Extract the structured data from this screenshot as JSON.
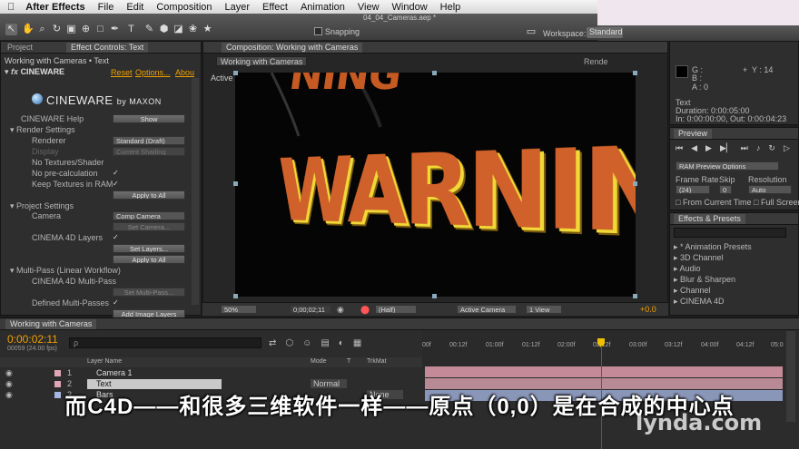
{
  "menubar": {
    "app_name": "After Effects",
    "items": [
      "File",
      "Edit",
      "Composition",
      "Layer",
      "Effect",
      "Animation",
      "View",
      "Window",
      "Help"
    ]
  },
  "document": {
    "title": "04_04_Cameras.aep *"
  },
  "toolbar": {
    "snapping_label": "Snapping",
    "workspace_label": "Workspace:",
    "workspace_value": "Standard"
  },
  "project_panel": {
    "tab_project": "Project",
    "tab_effect_controls": "Effect Controls: Text",
    "header": "Working with Cameras • Text"
  },
  "effect": {
    "name": "CINEWARE",
    "reset": "Reset",
    "options": "Options...",
    "about": "Abou",
    "logo_main": "CINEWARE",
    "logo_by": "by MAXON",
    "help_label": "CINEWARE Help",
    "help_button": "Show",
    "render_settings": "Render Settings",
    "renderer_label": "Renderer",
    "renderer_value": "Standard (Draft)",
    "display_label": "Display",
    "display_value": "Current Shading",
    "no_textures": "No Textures/Shader",
    "no_precalc": "No pre-calculation",
    "keep_textures": "Keep Textures in RAM",
    "apply_all_1": "Apply to All",
    "project_settings": "Project Settings",
    "camera_label": "Camera",
    "camera_value": "Comp Camera",
    "set_camera": "Set Camera...",
    "c4d_layers": "CINEMA 4D Layers",
    "set_layers": "Set Layers...",
    "apply_all_2": "Apply to All",
    "multipass": "Multi-Pass (Linear Workflow)",
    "c4d_multipass": "CINEMA 4D Multi-Pass",
    "set_multipass": "Set Multi-Pass...",
    "defined_multipasses": "Defined Multi-Passes",
    "add_image_layers": "Add Image Layers"
  },
  "comp_panel": {
    "tab": "Composition: Working with Cameras",
    "subtab": "Working with Cameras",
    "renderer": "Rende",
    "view_label": "Active Camera",
    "canvas_text": "WARNING",
    "canvas_text_top": "NING",
    "zoom": "50%",
    "timecode": "0;00;02;11",
    "resolution": "(Half)",
    "camera_select": "Active Camera",
    "views": "1 View",
    "exposure": "+0.0"
  },
  "info_panel": {
    "g": "G :",
    "b": "B :",
    "a": "A : 0",
    "y": "Y : 14",
    "layer": "Text",
    "duration": "Duration: 0:00:05:00",
    "in_out": "In: 0:00:00:00, Out: 0:00:04:23"
  },
  "preview_panel": {
    "tab": "Preview",
    "ram_options": "RAM Preview Options",
    "frame_rate_label": "Frame Rate",
    "skip_label": "Skip",
    "resolution_label": "Resolution",
    "frame_rate_value": "(24)",
    "skip_value": "0",
    "resolution_value": "Auto",
    "from_current": "From Current Time",
    "full_screen": "Full Screen"
  },
  "effects_panel": {
    "tab": "Effects & Presets",
    "items": [
      "* Animation Presets",
      "3D Channel",
      "Audio",
      "Blur & Sharpen",
      "Channel",
      "CINEMA 4D"
    ]
  },
  "timeline": {
    "tab": "Working with Cameras",
    "timecode": "0:00:02:11",
    "fps": "00059 (24.00 fps)",
    "search_placeholder": "ρ",
    "col_layer_name": "Layer Name",
    "col_mode": "Mode",
    "col_t": "T",
    "col_trkmat": "TrkMat",
    "ruler": [
      "00f",
      "00:12f",
      "01:00f",
      "01:12f",
      "02:00f",
      "02:12f",
      "03:00f",
      "03:12f",
      "04:00f",
      "04:12f",
      "05:0"
    ],
    "layers": [
      {
        "num": "1",
        "name": "Camera 1",
        "color": "#e0a6b6",
        "mode": ""
      },
      {
        "num": "2",
        "name": "Text",
        "color": "#e0a6b6",
        "mode": "Normal"
      },
      {
        "num": "3",
        "name": "Bars",
        "color": "#a6b6e0",
        "mode": "None"
      }
    ]
  },
  "subtitle": {
    "text": "而C4D——和很多三维软件一样——原点（0,0）是在合成的中心点"
  },
  "watermark": {
    "text": "lynda.com"
  }
}
